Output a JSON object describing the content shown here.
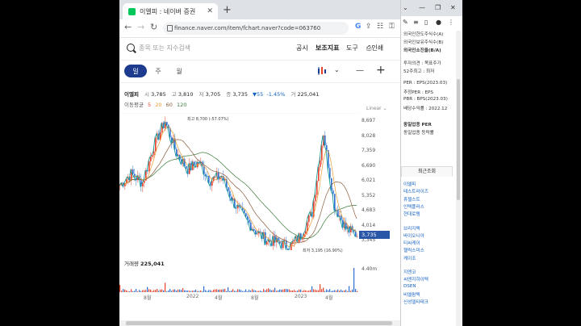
{
  "browser": {
    "tab_title": "이엘피 : 네이버 증권",
    "url": "finance.naver.com/item/fchart.naver?code=063760"
  },
  "search": {
    "placeholder": "종목 또는 지수검색"
  },
  "top_menu": [
    "공시",
    "보조지표",
    "도구",
    "인쇄"
  ],
  "periods": [
    "일",
    "주",
    "월"
  ],
  "stock": {
    "name": "이엘피",
    "open_label": "시",
    "open": "3,785",
    "high_label": "고",
    "high": "3,810",
    "low_label": "저",
    "low": "3,705",
    "close": "3,735",
    "change": "▼55",
    "change_pct": "-1.45%",
    "volume_label": "거",
    "volume": "225,041"
  },
  "moving_avg": {
    "label": "이동평균",
    "periods": [
      "5",
      "20",
      "60",
      "120"
    ],
    "colors": [
      "#e8412c",
      "#e89a2c",
      "#8c5a3a",
      "#3a7a3a"
    ]
  },
  "scale_label": "Linear",
  "y_labels": [
    "8,697",
    "8,028",
    "7,359",
    "6,690",
    "6,021",
    "5,352",
    "4,683",
    "4,014",
    "3,345"
  ],
  "current_price_tag": "3,735",
  "high_annotation": "최고 8,700 (-57.07%)",
  "low_annotation": "최저 3,195 (16.90%)",
  "volume_panel": {
    "label": "거래량",
    "value": "225,041",
    "max_label": "4.40m"
  },
  "x_labels": [
    "8월",
    "2022",
    "4월",
    "8월",
    "2023",
    "4월"
  ],
  "chart_data": {
    "type": "line",
    "title": "",
    "x": [
      "8월",
      "2022",
      "4월",
      "8월",
      "2023",
      "4월"
    ],
    "ylim": [
      3345,
      8697
    ],
    "series": [
      {
        "name": "",
        "values": [
          5900,
          6400,
          6000,
          7600,
          8700,
          7300,
          6600,
          6900,
          6100,
          6300,
          5200,
          4500,
          3900,
          3500,
          3400,
          3200,
          3700,
          4700,
          8200,
          5000,
          4000,
          3735
        ]
      }
    ],
    "volume_max": "4.40m",
    "grid": false
  },
  "sidebar": {
    "lines": [
      "외국인한도주식수(A)",
      "외국인보유주식수(B)",
      "외국인소진율(B/A)",
      "투자의견 : 목표주가",
      "52주최고 : 최저",
      "PER : EPS(2023.03)",
      "추정PER : EPS",
      "PBR : BPS(2023.03)",
      "배당수익률 : 2022.12",
      "동일업종 PER",
      "동일업종 등락률"
    ],
    "recent_title": "최근조회",
    "recent_items": [
      "이엘피",
      "테스트라이즈",
      "휴젤스트",
      "인텍플러스",
      "현대로템",
      "브리지텍",
      "바이오니아",
      "티씨케이",
      "헬릭스미스",
      "케이조",
      "지엔코",
      "씨엔지하이텍",
      "DSEN",
      "비엘팜텍",
      "신성델타테크"
    ]
  }
}
